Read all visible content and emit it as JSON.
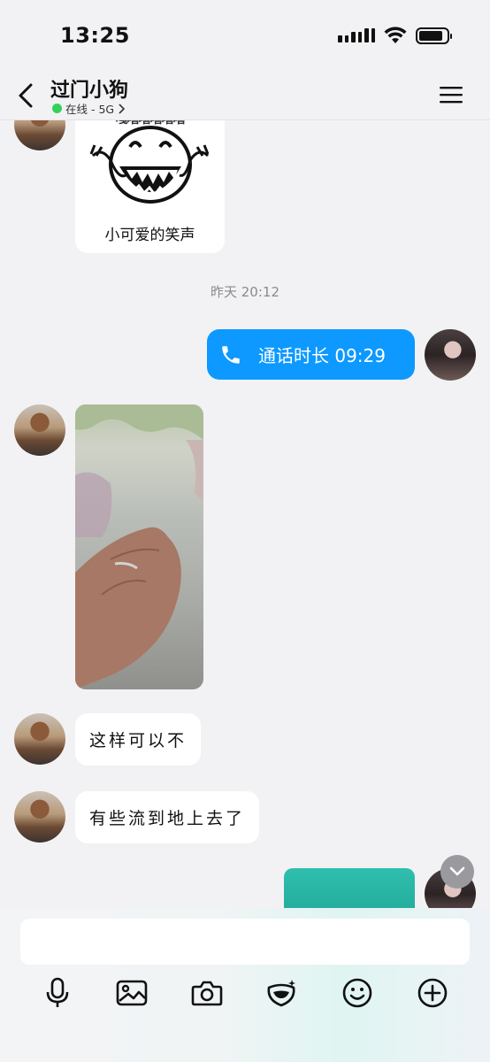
{
  "status_bar": {
    "time": "13:25",
    "battery_level": 0.85
  },
  "header": {
    "title": "过门小狗",
    "presence": "在线 - 5G",
    "presence_color": "#33d25a"
  },
  "messages": {
    "sticker_caption": "小可爱的笑声",
    "sticker_top_text": "嘎嘻嘻嘻嘻嘻",
    "timestamp": "昨天 20:12",
    "call": {
      "label": "通话时长 09:29",
      "color": "#0d99ff"
    },
    "texts": [
      "这样可以不",
      "有些流到地上去了"
    ]
  },
  "composer": {
    "placeholder": "",
    "tools": [
      "microphone-icon",
      "image-icon",
      "camera-icon",
      "sticker-icon",
      "emoji-icon",
      "plus-icon"
    ]
  },
  "colors": {
    "background": "#f2f2f4",
    "accent": "#0d99ff"
  }
}
